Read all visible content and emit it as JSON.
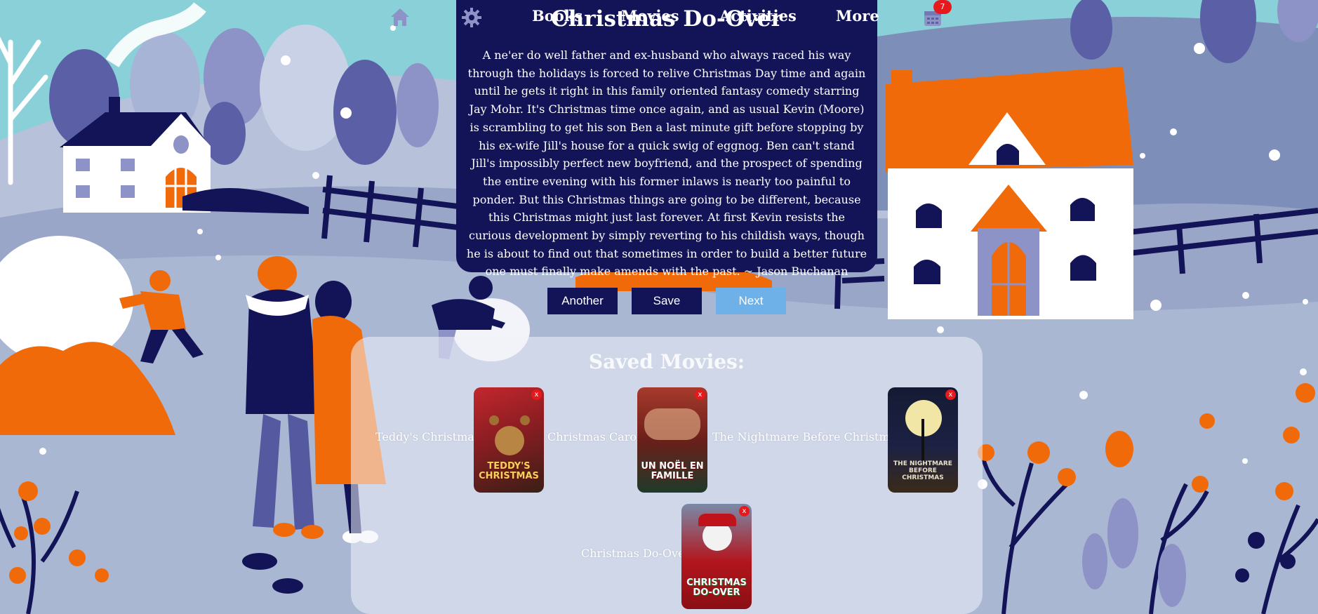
{
  "nav": {
    "books": "Books",
    "movies": "Movies",
    "activities": "Activities",
    "more": "More",
    "cart_count": "7"
  },
  "movie": {
    "title": "Christmas Do-Over",
    "description": "A ne'er do well father and ex-husband who always raced his way through the holidays is forced to relive Christmas Day time and again until he gets it right in this family oriented fantasy comedy starring Jay Mohr. It's Christmas time once again, and as usual Kevin (Moore) is scrambling to get his son Ben a last minute gift before stopping by his ex-wife Jill's house for a quick swig of eggnog. Ben can't stand Jill's impossibly perfect new boyfriend, and the prospect of spending the entire evening with his former inlaws is nearly too painful to ponder. But this Christmas things are going to be different, because this Christmas might just last forever. At first Kevin resists the curious development by simply reverting to his childish ways, though he is about to find out that sometimes in order to build a better future one must finally make amends with the past. ~ Jason Buchanan"
  },
  "buttons": {
    "another": "Another",
    "save": "Save",
    "next": "Next"
  },
  "saved": {
    "title": "Saved Movies:",
    "remove_label": "x",
    "items": [
      {
        "label": "Teddy's Christmas",
        "poster_text": "TEDDY'S CHRISTMAS"
      },
      {
        "label": "Christmas Carole",
        "poster_text": "UN NOËL EN FAMILLE"
      },
      {
        "label": "The Nightmare Before Christmas",
        "poster_text": "THE NIGHTMARE BEFORE CHRISTMAS"
      },
      {
        "label": "Christmas Do-Over",
        "poster_text": "CHRISTMAS DO-OVER"
      }
    ]
  },
  "colors": {
    "navy": "#131458",
    "orange": "#f06a0a",
    "sky": "#8ad0d8",
    "next_button": "#6eb0e8",
    "badge": "#e8191c"
  }
}
